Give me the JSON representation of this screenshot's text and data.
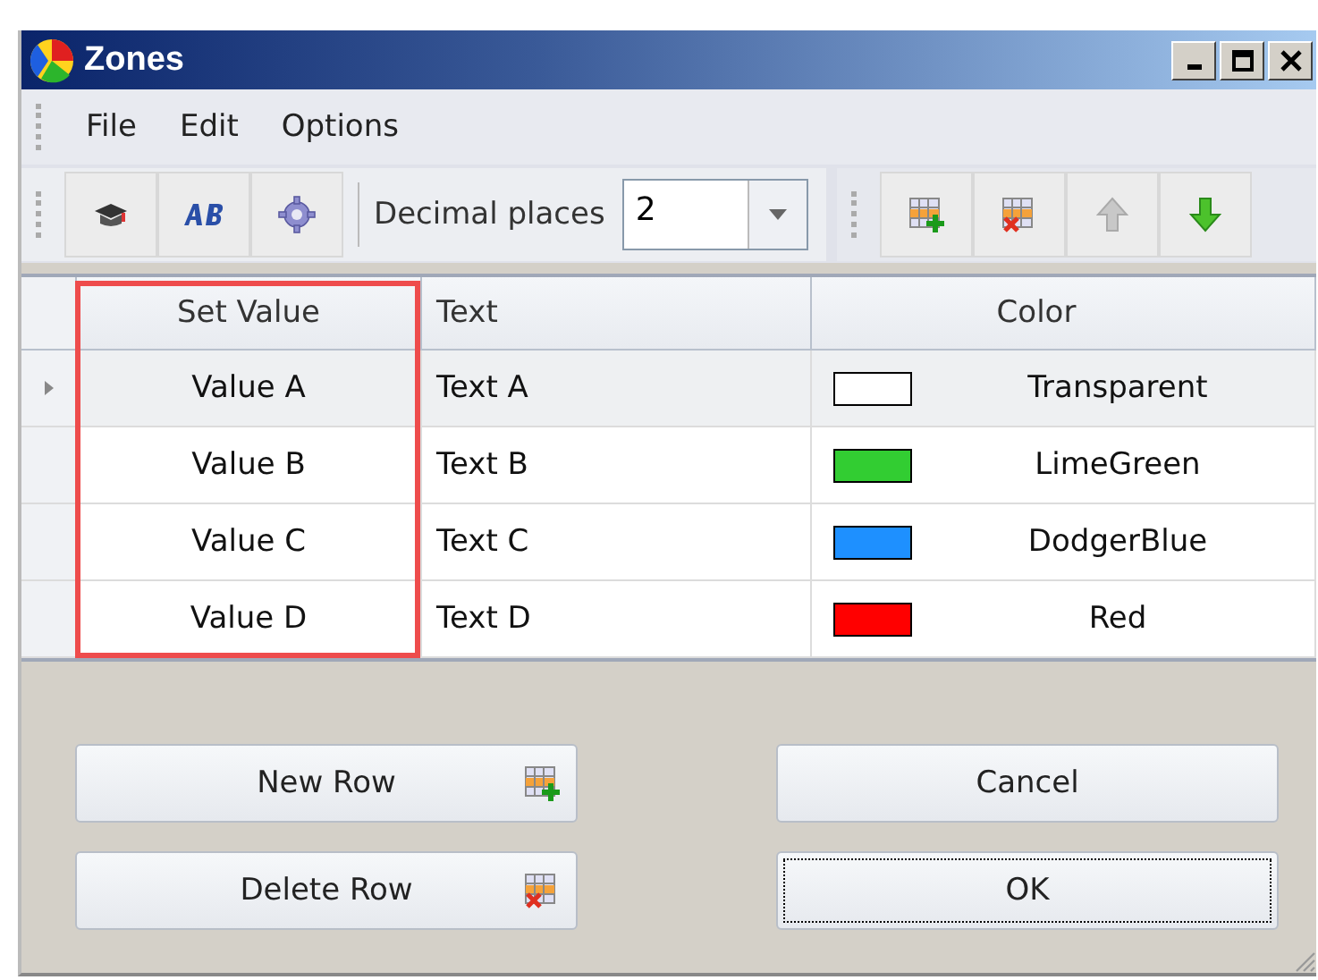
{
  "window": {
    "title": "Zones"
  },
  "menu": [
    "File",
    "Edit",
    "Options"
  ],
  "toolbar": {
    "decimal_places": {
      "label": "Decimal places",
      "value": "2"
    }
  },
  "table": {
    "columns": [
      {
        "label": "Set Value",
        "highlighted": true
      },
      {
        "label": "Text",
        "highlighted": false
      },
      {
        "label": "Color",
        "highlighted": false
      }
    ],
    "rows": [
      {
        "set_value": "Value A",
        "text": "Text A",
        "color_name": "Transparent",
        "color": "#ffffff",
        "selected": true
      },
      {
        "set_value": "Value B",
        "text": "Text B",
        "color_name": "LimeGreen",
        "color": "#32cd32",
        "selected": false
      },
      {
        "set_value": "Value C",
        "text": "Text C",
        "color_name": "DodgerBlue",
        "color": "#1e90ff",
        "selected": false
      },
      {
        "set_value": "Value D",
        "text": "Text D",
        "color_name": "Red",
        "color": "#ff0000",
        "selected": false
      }
    ]
  },
  "buttons": [
    {
      "label": "New Row",
      "kind": "add",
      "focused": false
    },
    {
      "label": "Cancel",
      "kind": "plain",
      "focused": false
    },
    {
      "label": "Delete Row",
      "kind": "delete",
      "focused": false
    },
    {
      "label": "OK",
      "kind": "plain",
      "focused": true
    }
  ]
}
